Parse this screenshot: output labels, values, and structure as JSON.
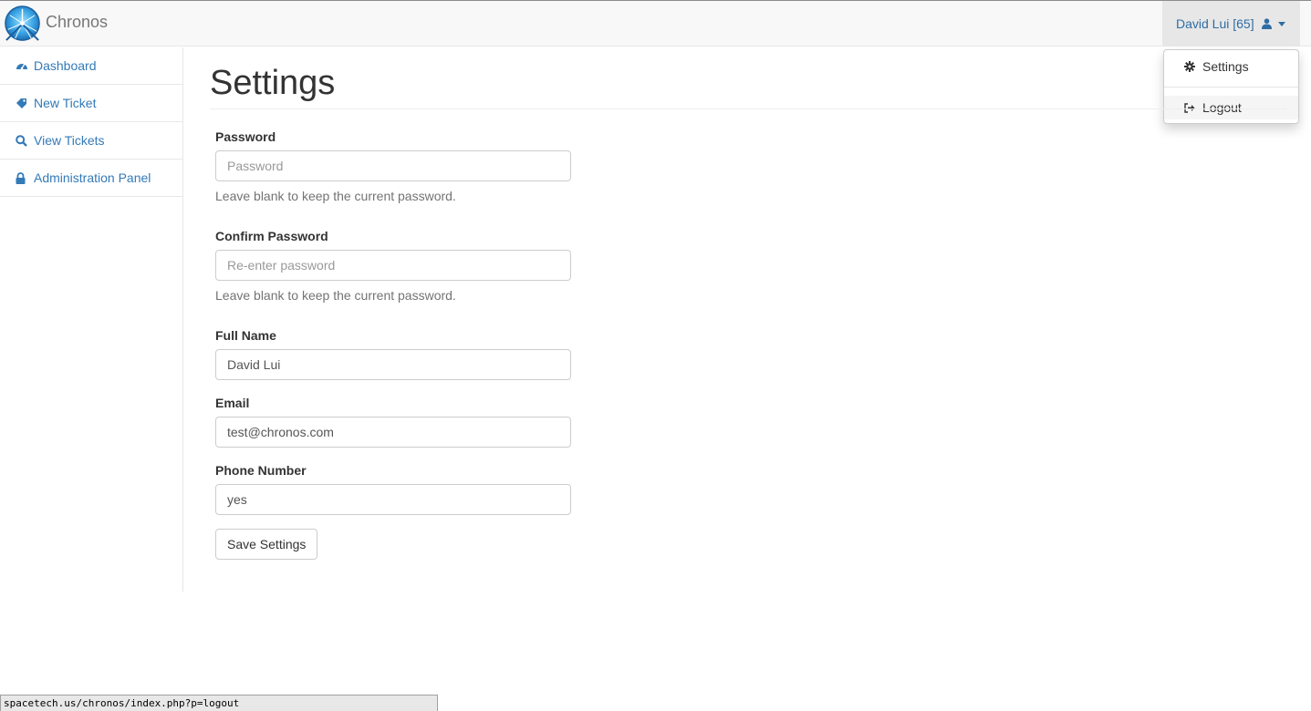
{
  "brand": {
    "name": "Chronos",
    "logo_icon": "chronos-logo-icon"
  },
  "user_menu": {
    "label": "David Lui [65]",
    "icon": "user-icon",
    "items": [
      {
        "label": "Settings",
        "icon": "gear-icon"
      },
      {
        "label": "Logout",
        "icon": "logout-icon"
      }
    ]
  },
  "sidebar": {
    "items": [
      {
        "label": "Dashboard",
        "icon": "dashboard-icon"
      },
      {
        "label": "New Ticket",
        "icon": "tag-icon"
      },
      {
        "label": "View Tickets",
        "icon": "search-icon"
      },
      {
        "label": "Administration Panel",
        "icon": "lock-icon"
      }
    ]
  },
  "page": {
    "title": "Settings"
  },
  "form": {
    "password": {
      "label": "Password",
      "placeholder": "Password",
      "value": "",
      "help": "Leave blank to keep the current password."
    },
    "confirm_password": {
      "label": "Confirm Password",
      "placeholder": "Re-enter password",
      "value": "",
      "help": "Leave blank to keep the current password."
    },
    "full_name": {
      "label": "Full Name",
      "value": "David Lui"
    },
    "email": {
      "label": "Email",
      "value": "test@chronos.com"
    },
    "phone": {
      "label": "Phone Number",
      "value": "yes"
    },
    "save_label": "Save Settings"
  },
  "status_bar": {
    "url": "spacetech.us/chronos/index.php?p=logout"
  },
  "colors": {
    "link": "#337ab7",
    "navbar_bg": "#f8f8f8",
    "active_nav": "#e7e7e7"
  }
}
